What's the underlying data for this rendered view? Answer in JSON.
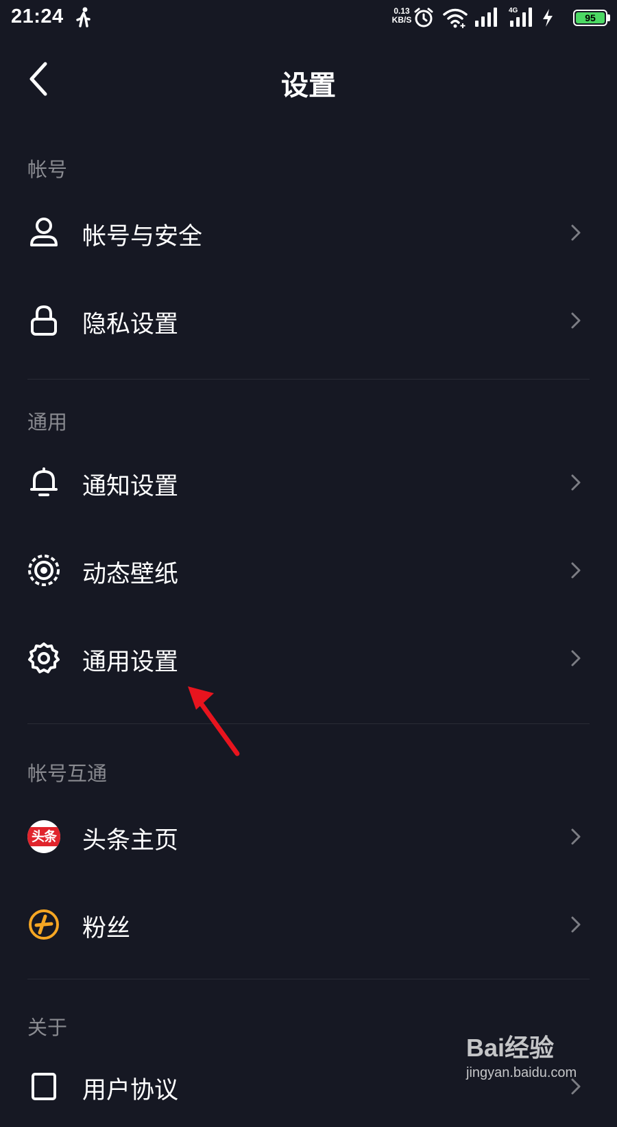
{
  "status_bar": {
    "time": "21:24",
    "net_speed_value": "0.13",
    "net_speed_unit": "KB/S",
    "network_type": "4G",
    "battery_level": "95",
    "icons": [
      "walking-icon",
      "alarm-icon",
      "wifi-icon",
      "signal-icon",
      "charging-icon",
      "battery-icon"
    ]
  },
  "header": {
    "title": "设置",
    "back_icon": "chevron-left-icon"
  },
  "sections": [
    {
      "title": "帐号",
      "items": [
        {
          "label": "帐号与安全",
          "icon": "person-icon"
        },
        {
          "label": "隐私设置",
          "icon": "lock-icon"
        }
      ]
    },
    {
      "title": "通用",
      "items": [
        {
          "label": "通知设置",
          "icon": "bell-icon"
        },
        {
          "label": "动态壁纸",
          "icon": "live-wallpaper-icon"
        },
        {
          "label": "通用设置",
          "icon": "gear-icon"
        }
      ]
    },
    {
      "title": "帐号互通",
      "items": [
        {
          "label": "头条主页",
          "icon": "toutiao-logo",
          "logo_text": "头条"
        },
        {
          "label": "粉丝",
          "icon": "fans-icon"
        }
      ]
    },
    {
      "title": "关于",
      "items": [
        {
          "label": "用户协议",
          "icon": "document-icon"
        }
      ]
    }
  ],
  "annotation": {
    "arrow_color": "#e8141e",
    "target": "通用设置"
  },
  "watermark": {
    "brand": "Bai经验",
    "url": "jingyan.baidu.com"
  },
  "colors": {
    "background": "#161823",
    "text": "#ffffff",
    "secondary_text": "#8a8b91",
    "divider": "#2a2c36"
  }
}
